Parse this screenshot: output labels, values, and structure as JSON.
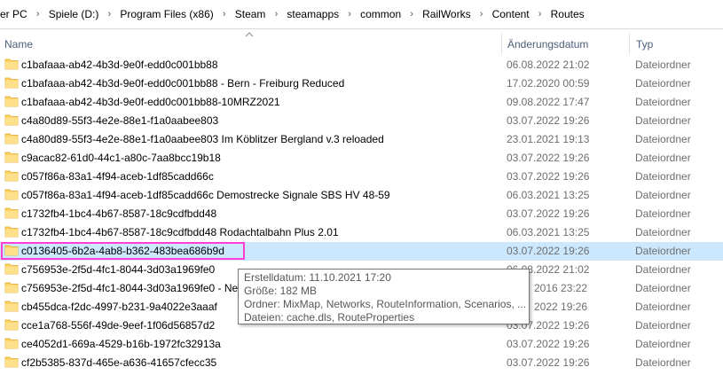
{
  "breadcrumb": [
    "er PC",
    "Spiele (D:)",
    "Program Files (x86)",
    "Steam",
    "steamapps",
    "common",
    "RailWorks",
    "Content",
    "Routes"
  ],
  "columns": {
    "name": "Name",
    "date": "Änderungsdatum",
    "type": "Typ"
  },
  "rows": [
    {
      "name": "c1bafaaa-ab42-4b3d-9e0f-edd0c001bb88",
      "date": "06.08.2022 21:02",
      "type": "Dateiordner"
    },
    {
      "name": "c1bafaaa-ab42-4b3d-9e0f-edd0c001bb88 - Bern - Freiburg Reduced",
      "date": "17.02.2020 00:59",
      "type": "Dateiordner"
    },
    {
      "name": "c1bafaaa-ab42-4b3d-9e0f-edd0c001bb88-10MRZ2021",
      "date": "09.08.2022 17:47",
      "type": "Dateiordner"
    },
    {
      "name": "c4a80d89-55f3-4e2e-88e1-f1a0aabee803",
      "date": "03.07.2022 19:26",
      "type": "Dateiordner"
    },
    {
      "name": "c4a80d89-55f3-4e2e-88e1-f1a0aabee803  Im Köblitzer Bergland v.3 reloaded",
      "date": "23.01.2021 19:13",
      "type": "Dateiordner"
    },
    {
      "name": "c9acac82-61d0-44c1-a80c-7aa8bcc19b18",
      "date": "03.07.2022 19:26",
      "type": "Dateiordner"
    },
    {
      "name": "c057f86a-83a1-4f94-aceb-1df85cadd66c",
      "date": "03.07.2022 19:26",
      "type": "Dateiordner"
    },
    {
      "name": "c057f86a-83a1-4f94-aceb-1df85cadd66c  Demostrecke Signale SBS HV 48-59",
      "date": "06.03.2021 13:25",
      "type": "Dateiordner"
    },
    {
      "name": "c1732fb4-1bc4-4b67-8587-18c9cdfbdd48",
      "date": "03.07.2022 19:26",
      "type": "Dateiordner"
    },
    {
      "name": "c1732fb4-1bc4-4b67-8587-18c9cdfbdd48  Rodachtalbahn Plus 2.01",
      "date": "06.03.2021 13:25",
      "type": "Dateiordner"
    },
    {
      "name": "c0136405-6b2a-4ab8-b362-483bea686b9d",
      "date": "03.07.2022 19:26",
      "type": "Dateiordner",
      "selected": true
    },
    {
      "name": "c756953e-2f5d-4fc1-8044-3d03a1969fe0",
      "date": "06.08.2022 21:02",
      "type": "Dateiordner"
    },
    {
      "name": "c756953e-2f5d-4fc1-8044-3d03a1969fe0 - Neue",
      "date": "2016 23:22",
      "type": "Dateiordner"
    },
    {
      "name": "cb455dca-f2dc-4997-b231-9a4022e3aaaf",
      "date": "2022 19:26",
      "type": "Dateiordner"
    },
    {
      "name": "cce1a768-556f-49de-9eef-1f06d56857d2",
      "date": "03.07.2022 19:26",
      "type": "Dateiordner"
    },
    {
      "name": "ce4052d1-669a-4529-b16b-1972fc32913a",
      "date": "03.07.2022 19:26",
      "type": "Dateiordner"
    },
    {
      "name": "cf2b5385-837d-465e-a636-41657cfecc35",
      "date": "03.07.2022 19:26",
      "type": "Dateiordner"
    }
  ],
  "tooltip": {
    "created": "Erstelldatum: 11.10.2021 17:20",
    "size": "Größe: 182 MB",
    "folders": "Ordner: MixMap, Networks, RouteInformation, Scenarios, ...",
    "files": "Dateien: cache.dls, RouteProperties"
  },
  "icons": {
    "folder": "folder-icon",
    "sort": "sort-up-arrow-icon",
    "chevron": "chevron-right-icon"
  },
  "colors": {
    "selection": "#cce8ff",
    "highlight": "#ff3fd7",
    "folder": "#ffd15c"
  }
}
